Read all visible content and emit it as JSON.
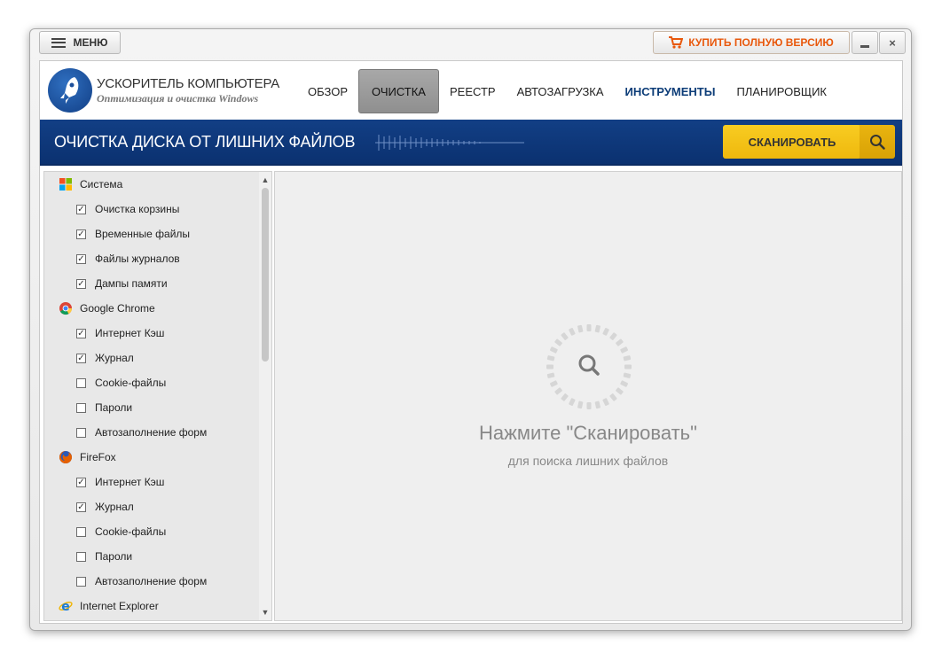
{
  "titlebar": {
    "menu_label": "МЕНЮ",
    "buy_label": "КУПИТЬ ПОЛНУЮ ВЕРСИЮ",
    "close_label": "×"
  },
  "header": {
    "app_title": "УСКОРИТЕЛЬ КОМПЬЮТЕРА",
    "app_subtitle": "Оптимизация и очистка Windows",
    "nav": [
      {
        "label": "ОБЗОР"
      },
      {
        "label": "ОЧИСТКА"
      },
      {
        "label": "РЕЕСТР"
      },
      {
        "label": "АВТОЗАГРУЗКА"
      },
      {
        "label": "ИНСТРУМЕНТЫ"
      },
      {
        "label": "ПЛАНИРОВЩИК"
      }
    ]
  },
  "bluebar": {
    "title": "ОЧИСТКА ДИСКА ОТ ЛИШНИХ ФАЙЛОВ",
    "scan_label": "СКАНИРОВАТЬ"
  },
  "tree": {
    "system": {
      "label": "Система",
      "items": [
        {
          "label": "Очистка корзины",
          "checked": true
        },
        {
          "label": "Временные файлы",
          "checked": true
        },
        {
          "label": "Файлы журналов",
          "checked": true
        },
        {
          "label": "Дампы памяти",
          "checked": true
        }
      ]
    },
    "chrome": {
      "label": "Google Chrome",
      "items": [
        {
          "label": "Интернет Кэш",
          "checked": true
        },
        {
          "label": "Журнал",
          "checked": true
        },
        {
          "label": "Cookie-файлы",
          "checked": false
        },
        {
          "label": "Пароли",
          "checked": false
        },
        {
          "label": "Автозаполнение форм",
          "checked": false
        }
      ]
    },
    "firefox": {
      "label": "FireFox",
      "items": [
        {
          "label": "Интернет Кэш",
          "checked": true
        },
        {
          "label": "Журнал",
          "checked": true
        },
        {
          "label": "Cookie-файлы",
          "checked": false
        },
        {
          "label": "Пароли",
          "checked": false
        },
        {
          "label": "Автозаполнение форм",
          "checked": false
        }
      ]
    },
    "ie": {
      "label": "Internet Explorer"
    }
  },
  "main": {
    "title": "Нажмите \"Сканировать\"",
    "subtitle": "для поиска лишних файлов"
  },
  "colors": {
    "accent_blue": "#123f85",
    "scan_yellow": "#f5c31c",
    "buy_orange": "#e8580c"
  }
}
